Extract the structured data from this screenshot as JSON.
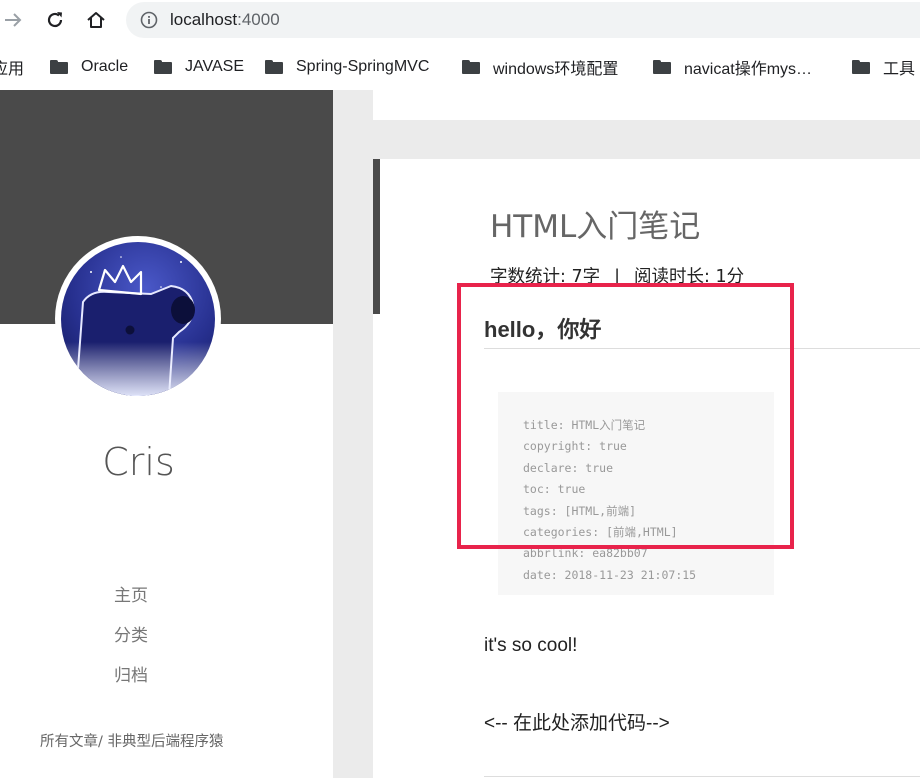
{
  "browser": {
    "url_host": "localhost",
    "url_port": ":4000",
    "bookmarks": [
      {
        "label": "应用",
        "icon": "apps-icon"
      },
      {
        "label": "Oracle",
        "icon": "folder-icon"
      },
      {
        "label": "JAVASE",
        "icon": "folder-icon"
      },
      {
        "label": "Spring-SpringMVC",
        "icon": "folder-icon"
      },
      {
        "label": "windows环境配置",
        "icon": "folder-icon"
      },
      {
        "label": "navicat操作mys…",
        "icon": "folder-icon"
      },
      {
        "label": "工具",
        "icon": "folder-icon"
      }
    ]
  },
  "sidebar": {
    "author": "Cris",
    "menu": [
      {
        "label": "主页"
      },
      {
        "label": "分类"
      },
      {
        "label": "归档"
      }
    ],
    "footer": "所有文章/ 非典型后端程序猿"
  },
  "post": {
    "title": "HTML入门笔记",
    "word_count": "字数统计: 7字",
    "meta_separator": "|",
    "read_time": "阅读时长: 1分",
    "heading": "hello，你好",
    "front_matter": [
      "title: HTML入门笔记",
      "copyright: true",
      "declare: true",
      "toc: true",
      "tags: [HTML,前端]",
      "categories: [前端,HTML]",
      "abbrlink: ea82bb07",
      "date: 2018-11-23 21:07:15"
    ],
    "paragraph_1": "it's so cool!",
    "paragraph_2": "<-- 在此处添加代码-->"
  },
  "colors": {
    "highlight_border": "#e8234b",
    "sidebar_banner": "#4a4a4a",
    "gutter": "#ebebeb"
  }
}
